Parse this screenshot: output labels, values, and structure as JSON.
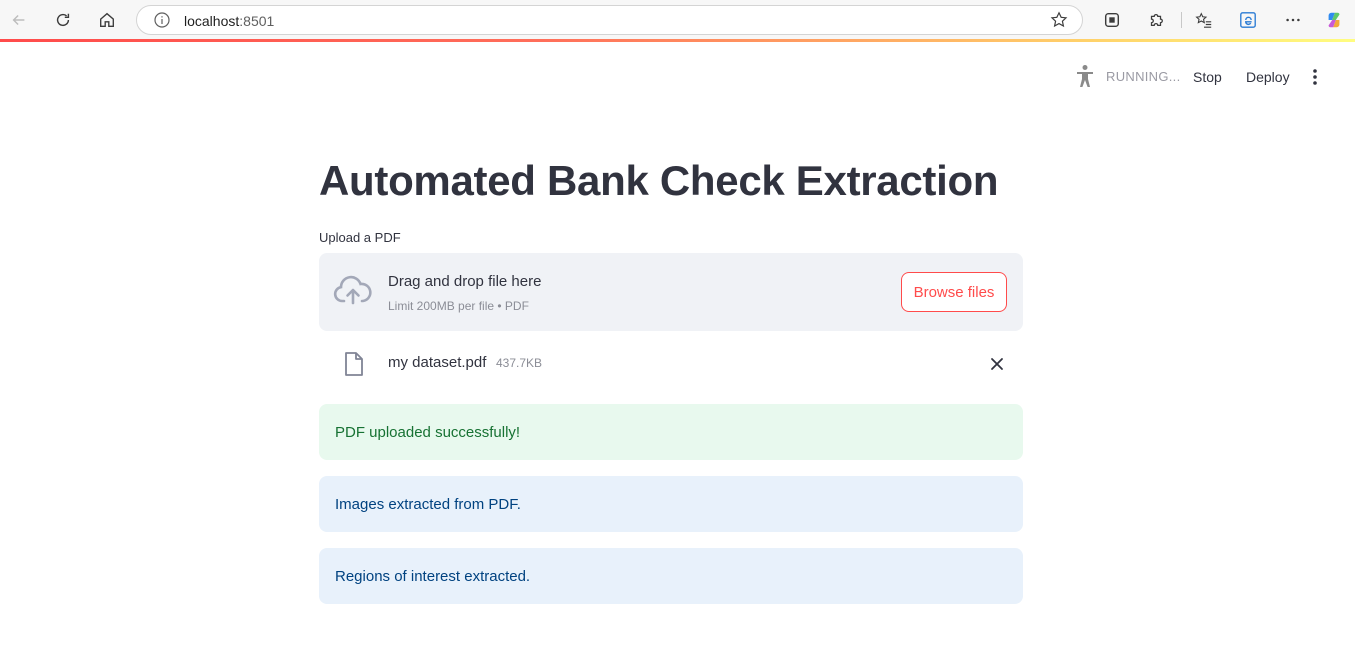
{
  "browser": {
    "url_host": "localhost",
    "url_port": ":8501"
  },
  "header": {
    "status": "RUNNING...",
    "stop_label": "Stop",
    "deploy_label": "Deploy"
  },
  "main": {
    "title": "Automated Bank Check Extraction",
    "uploader": {
      "label": "Upload a PDF",
      "drop_text": "Drag and drop file here",
      "limit_text": "Limit 200MB per file • PDF",
      "browse_label": "Browse files"
    },
    "file": {
      "name": "my dataset.pdf",
      "size": "437.7KB"
    },
    "alerts": [
      {
        "text": "PDF uploaded successfully!",
        "kind": "success"
      },
      {
        "text": "Images extracted from PDF.",
        "kind": "info"
      },
      {
        "text": "Regions of interest extracted.",
        "kind": "info"
      }
    ]
  },
  "colors": {
    "accent": "#ff4b4b",
    "success_bg": "#e8f9ee",
    "success_text": "#177233",
    "info_bg": "#e8f1fb",
    "info_text": "#004280",
    "dropzone_bg": "#f0f2f6"
  }
}
